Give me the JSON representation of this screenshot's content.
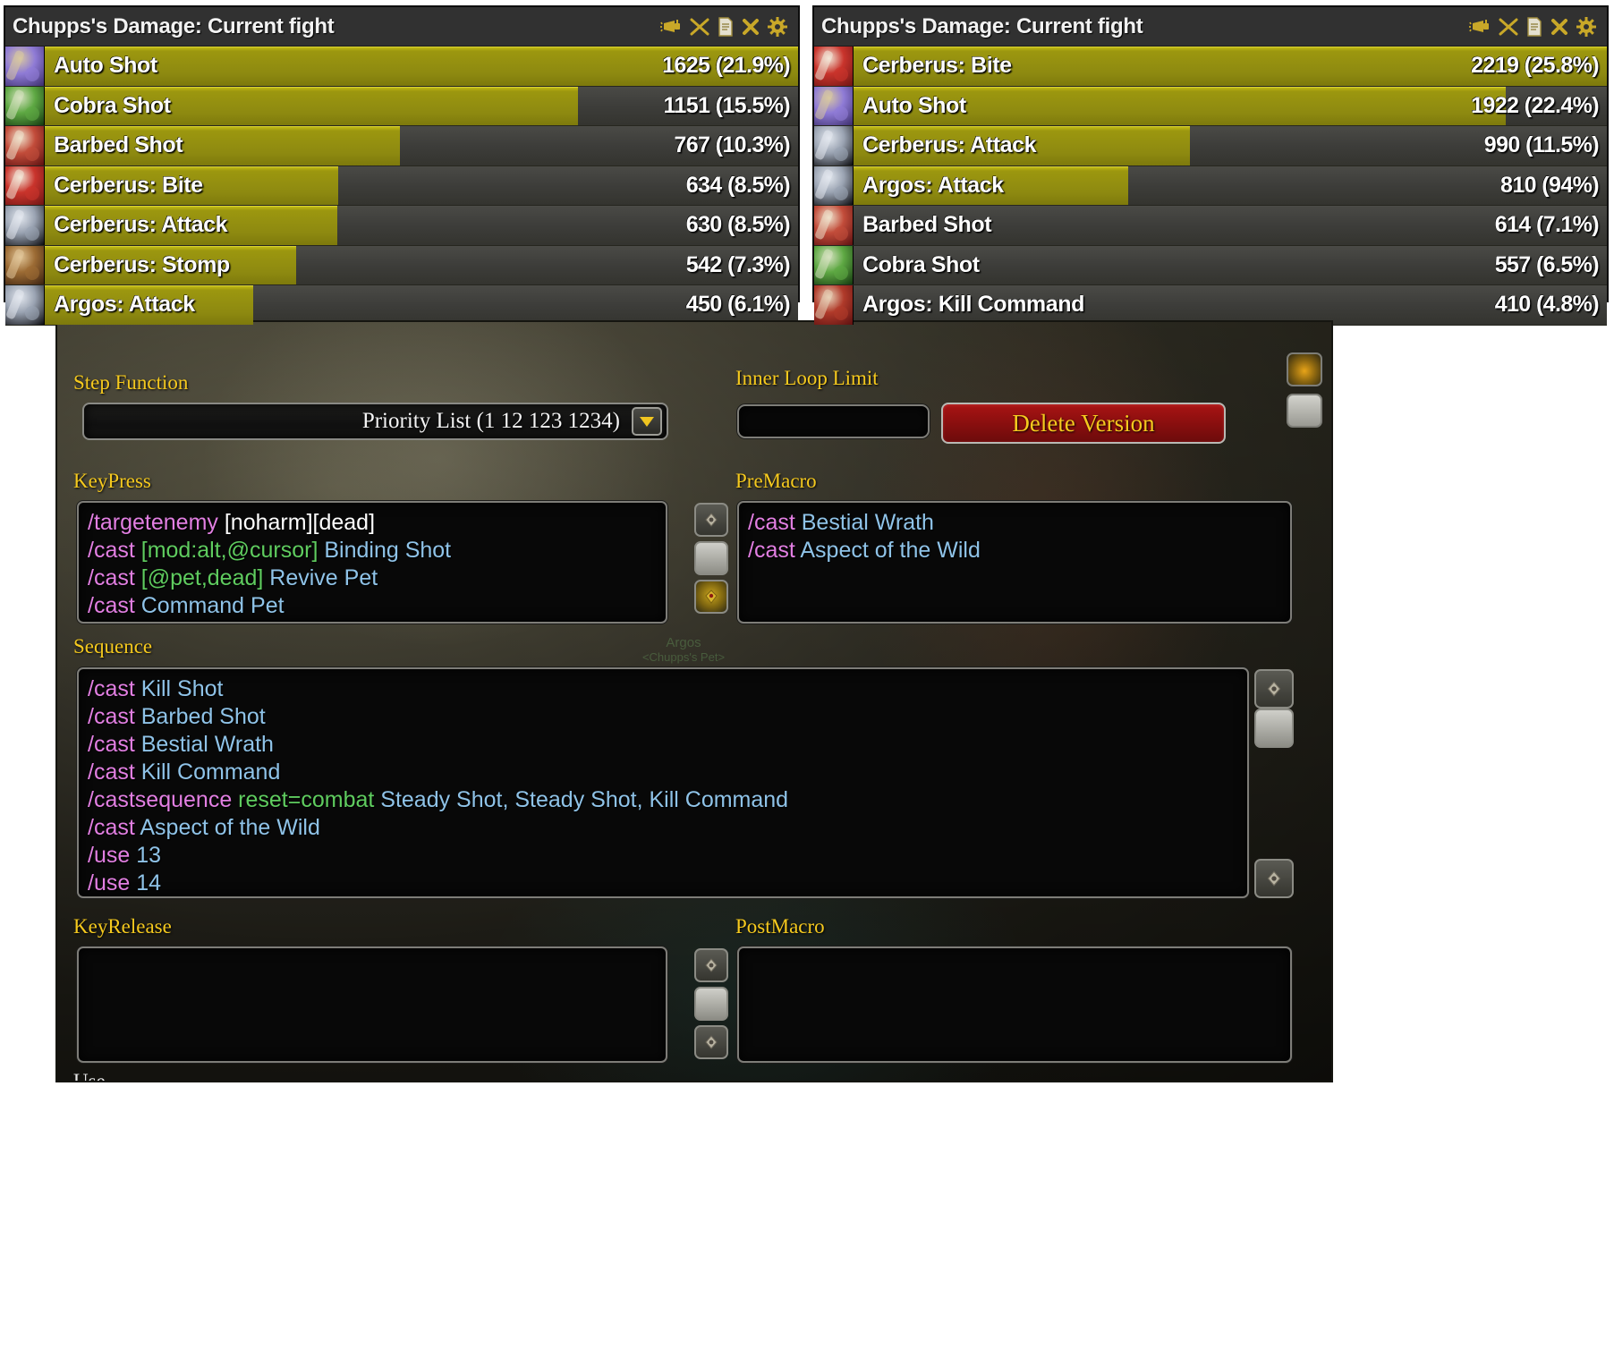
{
  "meters": [
    {
      "title": "Chupps's Damage: Current fight",
      "icons": [
        "horn-icon",
        "swords-icon",
        "report-icon",
        "close-icon",
        "gear-icon"
      ],
      "rows": [
        {
          "label": "Auto Shot",
          "value": "1625 (21.9%)",
          "pct": 100.0,
          "icon_colors": [
            "#3b2d6b",
            "#8f7bd6",
            "#d8c8a0"
          ]
        },
        {
          "label": "Cobra Shot",
          "value": "1151 (15.5%)",
          "pct": 70.8,
          "icon_colors": [
            "#14380f",
            "#5ea843",
            "#d6e2c0"
          ]
        },
        {
          "label": "Barbed Shot",
          "value": "767 (10.3%)",
          "pct": 47.2,
          "icon_colors": [
            "#5c1010",
            "#c24c3a",
            "#efe2cc"
          ]
        },
        {
          "label": "Cerberus: Bite",
          "value": "634 (8.5%)",
          "pct": 39.0,
          "icon_colors": [
            "#6e1414",
            "#c9342c",
            "#f2e8d8"
          ]
        },
        {
          "label": "Cerberus: Attack",
          "value": "630 (8.5%)",
          "pct": 38.8,
          "icon_colors": [
            "#0b0b0f",
            "#9aa3b2",
            "#e3e8ef"
          ]
        },
        {
          "label": "Cerberus: Stomp",
          "value": "542 (7.3%)",
          "pct": 33.4,
          "icon_colors": [
            "#3a2110",
            "#9c6b34",
            "#e2c79a"
          ]
        },
        {
          "label": "Argos: Attack",
          "value": "450 (6.1%)",
          "pct": 27.7,
          "icon_colors": [
            "#0b0b0f",
            "#9aa3b2",
            "#e3e8ef"
          ]
        }
      ]
    },
    {
      "title": "Chupps's Damage: Current fight",
      "icons": [
        "horn-icon",
        "swords-icon",
        "report-icon",
        "close-icon",
        "gear-icon"
      ],
      "rows": [
        {
          "label": "Cerberus: Bite",
          "value": "2219 (25.8%)",
          "pct": 100.0,
          "icon_colors": [
            "#6e1414",
            "#c9342c",
            "#f2e8d8"
          ]
        },
        {
          "label": "Auto Shot",
          "value": "1922 (22.4%)",
          "pct": 86.6,
          "icon_colors": [
            "#3b2d6b",
            "#8f7bd6",
            "#d8c8a0"
          ]
        },
        {
          "label": "Cerberus: Attack",
          "value": "990 (11.5%)",
          "pct": 44.6,
          "icon_colors": [
            "#0b0b0f",
            "#9aa3b2",
            "#e3e8ef"
          ]
        },
        {
          "label": "Argos: Attack",
          "value": "810 (94%)",
          "pct": 36.5,
          "icon_colors": [
            "#0b0b0f",
            "#9aa3b2",
            "#e3e8ef"
          ]
        },
        {
          "label": "Barbed Shot",
          "value": "614 (7.1%)",
          "pct": 0.0,
          "icon_colors": [
            "#5c1010",
            "#c24c3a",
            "#efe2cc"
          ]
        },
        {
          "label": "Cobra Shot",
          "value": "557 (6.5%)",
          "pct": 0.0,
          "icon_colors": [
            "#14380f",
            "#5ea843",
            "#d6e2c0"
          ]
        },
        {
          "label": "Argos: Kill Command",
          "value": "410 (4.8%)",
          "pct": 0.0,
          "icon_colors": [
            "#5c1010",
            "#b03a2a",
            "#e8d2b8"
          ]
        }
      ]
    }
  ],
  "macro": {
    "step_function": {
      "label": "Step Function",
      "selected": "Priority List (1 12 123 1234)"
    },
    "inner_loop_limit": {
      "label": "Inner Loop Limit",
      "value": ""
    },
    "delete_version_label": "Delete Version",
    "keypress": {
      "label": "KeyPress",
      "lines": [
        [
          {
            "t": "/targetenemy ",
            "c": "c-cmd"
          },
          {
            "t": "[noharm][dead]",
            "c": "c-wht"
          }
        ],
        [
          {
            "t": "/cast ",
            "c": "c-cmd"
          },
          {
            "t": "[mod:alt,@cursor]",
            "c": "c-cond"
          },
          {
            "t": " Binding Shot",
            "c": "c-spl"
          }
        ],
        [
          {
            "t": "/cast ",
            "c": "c-cmd"
          },
          {
            "t": "[@pet,dead]",
            "c": "c-cond"
          },
          {
            "t": " Revive Pet",
            "c": "c-spl"
          }
        ],
        [
          {
            "t": "/cast ",
            "c": "c-cmd"
          },
          {
            "t": "Command Pet",
            "c": "c-spl"
          }
        ]
      ]
    },
    "premacro": {
      "label": "PreMacro",
      "lines": [
        [
          {
            "t": "/cast ",
            "c": "c-cmd"
          },
          {
            "t": "Bestial Wrath",
            "c": "c-spl"
          }
        ],
        [
          {
            "t": "/cast ",
            "c": "c-cmd"
          },
          {
            "t": "Aspect of the Wild",
            "c": "c-spl"
          }
        ]
      ]
    },
    "sequence": {
      "label": "Sequence",
      "lines": [
        [
          {
            "t": "/cast ",
            "c": "c-cmd"
          },
          {
            "t": "Kill Shot",
            "c": "c-spl"
          }
        ],
        [
          {
            "t": "/cast ",
            "c": "c-cmd"
          },
          {
            "t": "Barbed Shot",
            "c": "c-spl"
          }
        ],
        [
          {
            "t": "/cast ",
            "c": "c-cmd"
          },
          {
            "t": "Bestial Wrath",
            "c": "c-spl"
          }
        ],
        [
          {
            "t": "/cast ",
            "c": "c-cmd"
          },
          {
            "t": "Kill Command",
            "c": "c-spl"
          }
        ],
        [
          {
            "t": "/castsequence ",
            "c": "c-cmd"
          },
          {
            "t": " reset=combat ",
            "c": "c-cond"
          },
          {
            "t": " Steady Shot, Steady Shot, Kill Command",
            "c": "c-spl"
          }
        ],
        [
          {
            "t": "/cast ",
            "c": "c-cmd"
          },
          {
            "t": "Aspect of the Wild",
            "c": "c-spl"
          }
        ],
        [
          {
            "t": "/use ",
            "c": "c-cmd"
          },
          {
            "t": "13",
            "c": "c-num"
          }
        ],
        [
          {
            "t": "/use ",
            "c": "c-cmd"
          },
          {
            "t": "14",
            "c": "c-num"
          }
        ]
      ]
    },
    "keyrelease": {
      "label": "KeyRelease",
      "lines": []
    },
    "postmacro": {
      "label": "PostMacro",
      "lines": []
    },
    "bottom_clipped_label": "Use",
    "ghost_pet_name": "Argos",
    "ghost_pet_owner": "<Chupps's Pet>"
  },
  "colors": {
    "bar_yellow": "#9c970f",
    "label_gold": "#f5c91e",
    "delete_red": "#a81414",
    "cmd_magenta": "#e27fe2",
    "cond_green": "#5fcc5f",
    "spell_blue": "#8fc3e8"
  }
}
